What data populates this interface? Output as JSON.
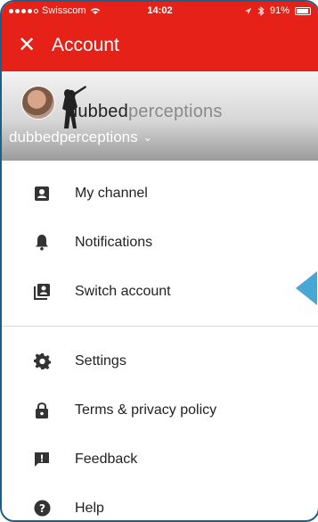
{
  "status": {
    "carrier": "Swisscom",
    "time": "14:02",
    "battery": "91%"
  },
  "appbar": {
    "close_label": "✕",
    "title": "Account"
  },
  "account": {
    "logo_text_main": "dubbed",
    "logo_text_faint": "perceptions",
    "username": "dubbedperceptions",
    "caret": "⌄"
  },
  "menu": {
    "section1": [
      {
        "label": "My channel",
        "icon": "person-icon"
      },
      {
        "label": "Notifications",
        "icon": "bell-icon"
      },
      {
        "label": "Switch account",
        "icon": "switch-account-icon"
      }
    ],
    "section2": [
      {
        "label": "Settings",
        "icon": "gear-icon"
      },
      {
        "label": "Terms & privacy policy",
        "icon": "lock-icon"
      },
      {
        "label": "Feedback",
        "icon": "feedback-icon"
      },
      {
        "label": "Help",
        "icon": "help-icon"
      }
    ]
  },
  "colors": {
    "brand": "#e62117",
    "pointer": "#49a7d5"
  }
}
